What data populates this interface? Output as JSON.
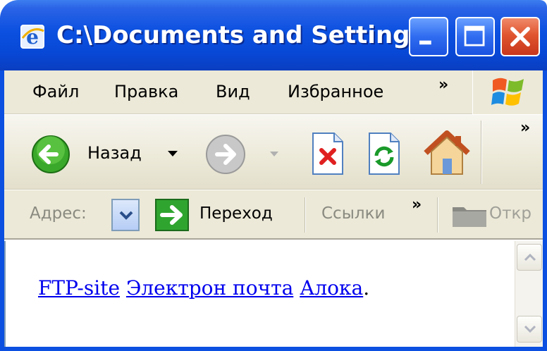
{
  "window": {
    "title": "C:\\Documents and Setting..."
  },
  "menubar": {
    "items": [
      "Файл",
      "Правка",
      "Вид",
      "Избранное"
    ],
    "overflow": "»"
  },
  "toolbar": {
    "back_label": "Назад",
    "overflow": "»"
  },
  "addressbar": {
    "label": "Адрес:",
    "go_label": "Переход",
    "links_label": "Ссылки",
    "links_overflow": "»",
    "open_label": "Откр"
  },
  "content": {
    "links": [
      "FTP-site",
      "Электрон почта",
      "Алока"
    ],
    "trailing_period": "."
  },
  "colors": {
    "titlebar": "#0b50e0",
    "link": "#0000ee",
    "close": "#e0552f"
  }
}
